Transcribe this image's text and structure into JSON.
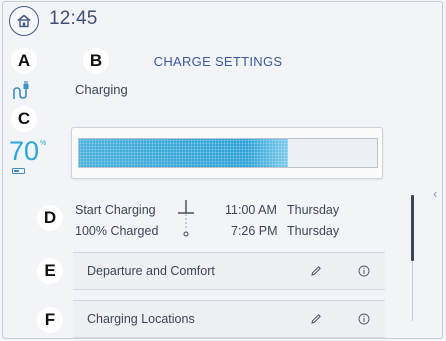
{
  "header": {
    "time": "12:45",
    "title": "CHARGE SETTINGS"
  },
  "callouts": {
    "a": "A",
    "b": "B",
    "c": "C",
    "d": "D",
    "e": "E",
    "f": "F"
  },
  "status": {
    "label": "Charging",
    "battery_percent": "70",
    "percent_symbol": "%",
    "charge_level": 0.7
  },
  "schedule": {
    "start": {
      "label": "Start Charging",
      "time": "11:00 AM",
      "day": "Thursday"
    },
    "complete": {
      "label": "100% Charged",
      "time": "7:26 PM",
      "day": "Thursday"
    }
  },
  "menu": {
    "departure": {
      "label": "Departure and Comfort"
    },
    "locations": {
      "label": "Charging Locations"
    }
  },
  "icons": {
    "home": "home-icon",
    "plug": "plug-icon",
    "battery": "battery-icon",
    "edit": "pencil-icon",
    "info": "info-icon",
    "chevron": "chevron-left-icon"
  },
  "colors": {
    "accent": "#3d5a9c",
    "charge_blue": "#2ba6d8",
    "text": "#3e4656"
  }
}
